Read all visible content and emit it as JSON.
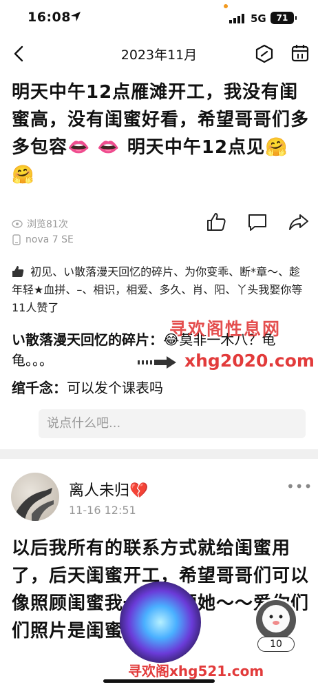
{
  "status_bar": {
    "time": "16:08",
    "network": "5G",
    "battery": "71"
  },
  "nav": {
    "title": "2023年11月",
    "icons": [
      "back-chevron-icon",
      "hexagon-icon",
      "calendar-icon"
    ]
  },
  "post": {
    "text": "明天中午12点雁滩开工，我没有闺蜜高，没有闺蜜好看，希望哥哥们多多包容👄 👄 明天中午12点见🤗🤗",
    "views": "浏览81次",
    "device": "nova 7 SE",
    "likes_text": "初见、い散落漫天回忆的碎片、为你变乖、断*章～、趁年轻★血拼、–、相识，相爱、多久、肖、阳、丫头我娶你等11人赞了",
    "comments": [
      {
        "author": "い散落漫天回忆的碎片：",
        "text": "😂莫非一木八？龟龟。。。"
      },
      {
        "author": "绾千念：",
        "text": "可以发个课表吗"
      }
    ],
    "input_placeholder": "说点什么吧..."
  },
  "next_post": {
    "user": "离人未归💔",
    "time": "11-16 12:51",
    "more": "•••",
    "text": "以后我所有的联系方式就给闺蜜用了，后天闺蜜开工，希望哥哥们可以像照顾闺蜜我一样照顾她～～爱你们们照片是闺蜜😁😁😁"
  },
  "floating": {
    "count": "10"
  },
  "watermarks": {
    "w1": "寻欢阁性息网",
    "w2": "xhg2020.com",
    "w3": "寻欢阁xhg521.com"
  },
  "colors": {
    "accent": "#f29a21",
    "watermark": "#e23b3b",
    "text": "#111111",
    "muted": "#999999"
  }
}
